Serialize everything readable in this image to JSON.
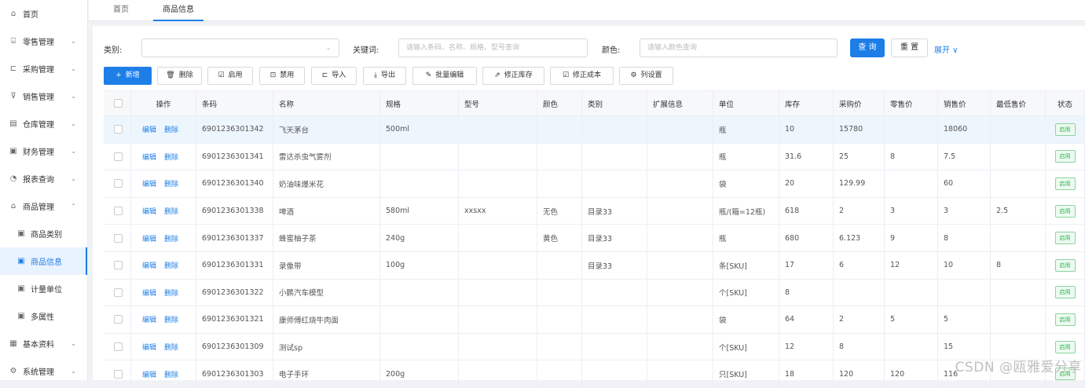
{
  "sidebar": {
    "items": [
      {
        "icon": "home-icon",
        "glyph": "⌂",
        "label": "首页",
        "arrow": ""
      },
      {
        "icon": "shop-icon",
        "glyph": "⌸",
        "label": "零售管理",
        "arrow": "⌄"
      },
      {
        "icon": "cart-icon",
        "glyph": "⊏",
        "label": "采购管理",
        "arrow": "⌄"
      },
      {
        "icon": "sale-icon",
        "glyph": "⊽",
        "label": "销售管理",
        "arrow": "⌄"
      },
      {
        "icon": "warehouse-icon",
        "glyph": "▤",
        "label": "仓库管理",
        "arrow": "⌄"
      },
      {
        "icon": "finance-icon",
        "glyph": "▣",
        "label": "财务管理",
        "arrow": "⌄"
      },
      {
        "icon": "report-icon",
        "glyph": "◔",
        "label": "报表查询",
        "arrow": "⌄"
      },
      {
        "icon": "goods-icon",
        "glyph": "⌂",
        "label": "商品管理",
        "arrow": "⌃"
      },
      {
        "icon": "category-icon",
        "glyph": "▣",
        "label": "商品类别",
        "arrow": ""
      },
      {
        "icon": "info-icon",
        "glyph": "▣",
        "label": "商品信息",
        "arrow": ""
      },
      {
        "icon": "unit-icon",
        "glyph": "▣",
        "label": "计量单位",
        "arrow": ""
      },
      {
        "icon": "attr-icon",
        "glyph": "▣",
        "label": "多属性",
        "arrow": ""
      },
      {
        "icon": "base-icon",
        "glyph": "▦",
        "label": "基本资料",
        "arrow": "⌄"
      },
      {
        "icon": "settings-icon",
        "glyph": "⚙",
        "label": "系统管理",
        "arrow": "⌄"
      }
    ]
  },
  "tabs": [
    {
      "label": "首页"
    },
    {
      "label": "商品信息"
    }
  ],
  "filters": {
    "category_label": "类别:",
    "keyword_label": "关键词:",
    "keyword_placeholder": "请输入条码、名称、规格、型号查询",
    "color_label": "颜色:",
    "color_placeholder": "请输入颜色查询",
    "search_button": "查 询",
    "reset_button": "重 置",
    "expand_link": "展开 ∨"
  },
  "toolbar": [
    {
      "icon": "plus-icon",
      "glyph": "+",
      "label": "新增",
      "primary": true
    },
    {
      "icon": "trash-icon",
      "glyph": "🗑",
      "label": "删除"
    },
    {
      "icon": "check-icon",
      "glyph": "☑",
      "label": "启用"
    },
    {
      "icon": "disable-icon",
      "glyph": "⊡",
      "label": "禁用"
    },
    {
      "icon": "import-icon",
      "glyph": "⊏",
      "label": "导入"
    },
    {
      "icon": "export-icon",
      "glyph": "⤓",
      "label": "导出"
    },
    {
      "icon": "edit-icon",
      "glyph": "✎",
      "label": "批量编辑"
    },
    {
      "icon": "stock-icon",
      "glyph": "⇗",
      "label": "修正库存"
    },
    {
      "icon": "cost-icon",
      "glyph": "☑",
      "label": "修正成本"
    },
    {
      "icon": "column-settings-icon",
      "glyph": "⚙",
      "label": "列设置"
    }
  ],
  "table": {
    "columns": [
      "",
      "操作",
      "条码",
      "名称",
      "规格",
      "型号",
      "颜色",
      "类别",
      "扩展信息",
      "单位",
      "库存",
      "采购价",
      "零售价",
      "销售价",
      "最低售价",
      "状态"
    ],
    "edit_label": "编辑",
    "delete_label": "删除",
    "rows": [
      [
        "6901236301342",
        "飞天茅台",
        "500ml",
        "",
        "",
        "",
        "",
        "瓶",
        "10",
        "15780",
        "",
        "18060",
        "",
        "启用"
      ],
      [
        "6901236301341",
        "雷达杀虫气雾剂",
        "",
        "",
        "",
        "",
        "",
        "瓶",
        "31.6",
        "25",
        "8",
        "7.5",
        "",
        "启用"
      ],
      [
        "6901236301340",
        "奶油味爆米花",
        "",
        "",
        "",
        "",
        "",
        "袋",
        "20",
        "129.99",
        "",
        "60",
        "",
        "启用"
      ],
      [
        "6901236301338",
        "啤酒",
        "580ml",
        "xxsxx",
        "无色",
        "目录33",
        "",
        "瓶/(箱=12瓶)",
        "618",
        "2",
        "3",
        "3",
        "2.5",
        "启用"
      ],
      [
        "6901236301337",
        "蜂蜜柚子茶",
        "240g",
        "",
        "黄色",
        "目录33",
        "",
        "瓶",
        "680",
        "6.123",
        "9",
        "8",
        "",
        "启用"
      ],
      [
        "6901236301331",
        "录像带",
        "100g",
        "",
        "",
        "目录33",
        "",
        "条[SKU]",
        "17",
        "6",
        "12",
        "10",
        "8",
        "启用"
      ],
      [
        "6901236301322",
        "小鹏汽车模型",
        "",
        "",
        "",
        "",
        "",
        "个[SKU]",
        "8",
        "",
        "",
        "",
        "",
        "启用"
      ],
      [
        "6901236301321",
        "康师傅红烧牛肉面",
        "",
        "",
        "",
        "",
        "",
        "袋",
        "64",
        "2",
        "5",
        "5",
        "",
        "启用"
      ],
      [
        "6901236301309",
        "测试sp",
        "",
        "",
        "",
        "",
        "",
        "个[SKU]",
        "12",
        "8",
        "",
        "15",
        "",
        "启用"
      ],
      [
        "6901236301303",
        "电子手环",
        "200g",
        "",
        "",
        "",
        "",
        "只[SKU]",
        "18",
        "120",
        "120",
        "116",
        "",
        "启用"
      ]
    ]
  },
  "watermark": "CSDN @瓯雅爱分享",
  "colors": {
    "accent": "#1e7ee8",
    "status_green": "#2bb04a"
  }
}
